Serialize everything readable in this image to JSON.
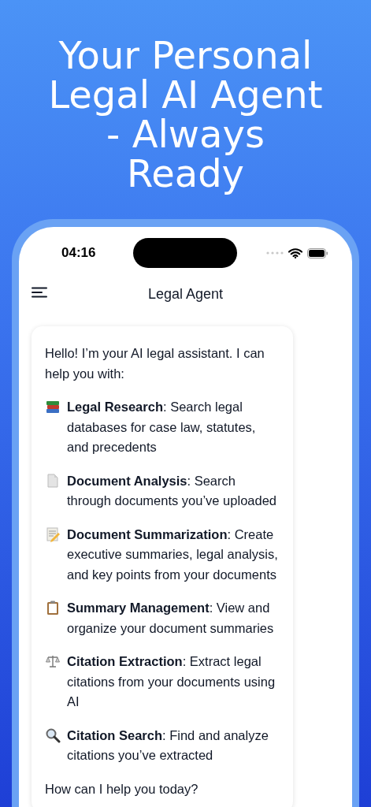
{
  "headline": "Your Personal Legal AI Agent - Always Ready",
  "status_bar": {
    "time": "04:16"
  },
  "nav": {
    "title": "Legal Agent"
  },
  "message": {
    "intro": "Hello! I’m your AI legal assistant. I can help you with:",
    "features": [
      {
        "kind": "books",
        "text": "**Legal Research**: Search legal databases for case law, statutes, and precedents"
      },
      {
        "kind": "page",
        "text": "**Document Analysis**: Search through documents you’ve uploaded"
      },
      {
        "kind": "memo",
        "text": "**Document Summarization**: Create executive summaries, legal analysis, and key points from your documents"
      },
      {
        "kind": "clipboard",
        "text": "**Summary Management**: View and organize your document summaries"
      },
      {
        "kind": "scales",
        "text": "**Citation Extraction**: Extract legal citations from your documents using AI"
      },
      {
        "kind": "magnifier",
        "text": "**Citation Search**: Find and analyze citations you’ve extracted"
      }
    ],
    "closing": "How can I help you today?"
  }
}
